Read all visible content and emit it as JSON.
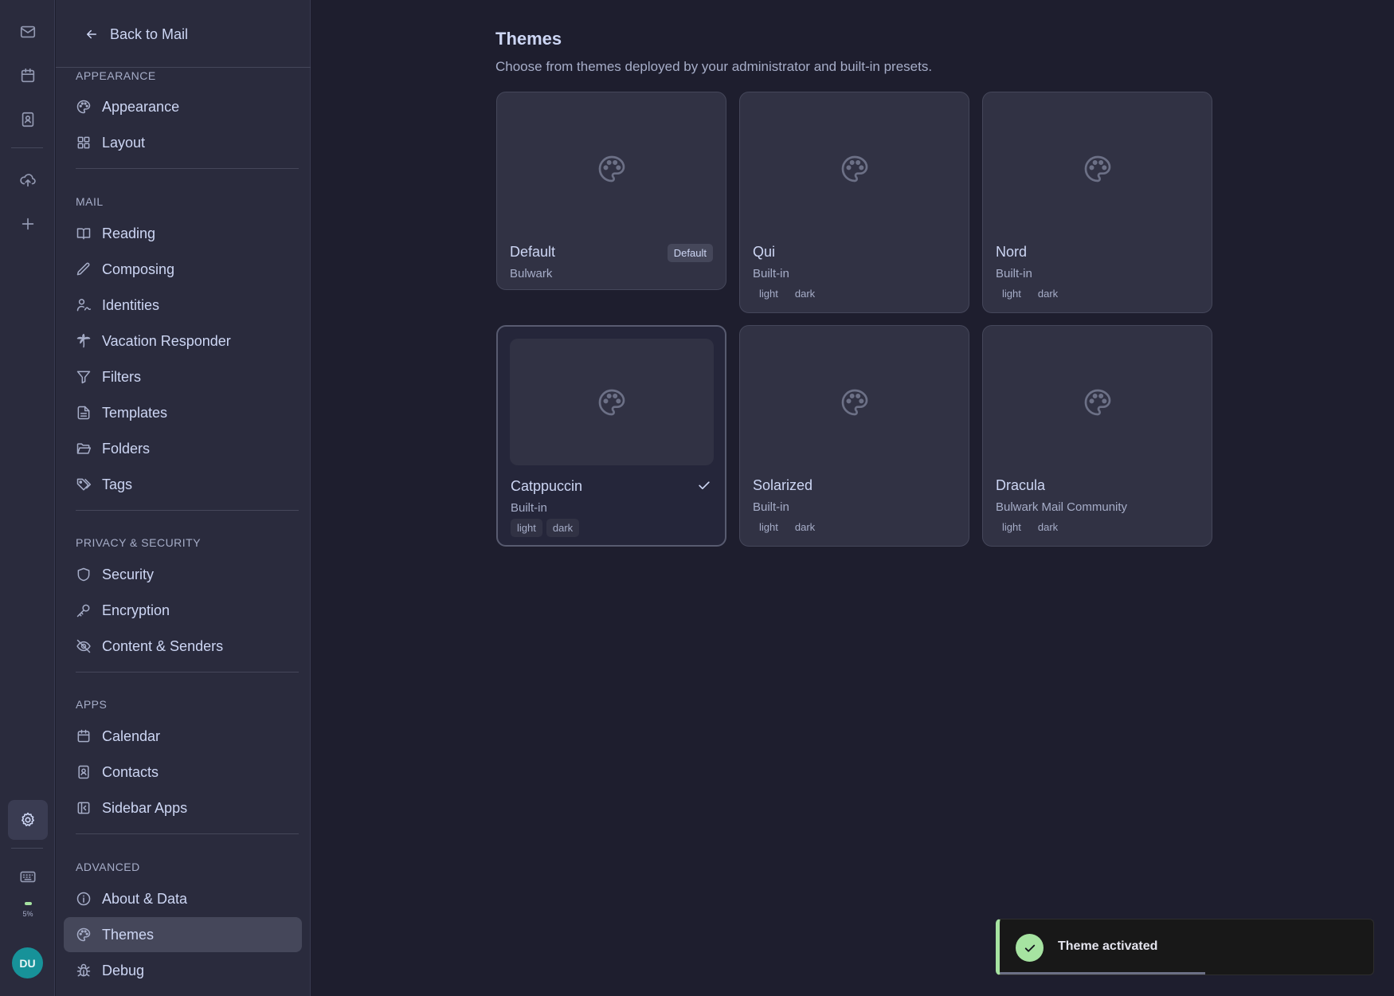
{
  "rail": {
    "icons": [
      "mail-icon",
      "calendar-icon",
      "contacts-icon",
      "cloud-upload-icon",
      "plus-icon",
      "settings-icon",
      "keyboard-icon"
    ],
    "storage_label": "5%",
    "storage_fraction": 0.05,
    "avatar_initials": "DU"
  },
  "sidebar": {
    "back_label": "Back to Mail",
    "sections": [
      {
        "title": "Appearance",
        "items": [
          {
            "label": "Appearance",
            "icon": "palette-icon"
          },
          {
            "label": "Layout",
            "icon": "layout-grid-icon"
          }
        ]
      },
      {
        "title": "Mail",
        "items": [
          {
            "label": "Reading",
            "icon": "book-icon"
          },
          {
            "label": "Composing",
            "icon": "pen-icon"
          },
          {
            "label": "Identities",
            "icon": "user-signature-icon"
          },
          {
            "label": "Vacation Responder",
            "icon": "palm-tree-icon"
          },
          {
            "label": "Filters",
            "icon": "filter-icon"
          },
          {
            "label": "Templates",
            "icon": "file-text-icon"
          },
          {
            "label": "Folders",
            "icon": "folder-open-icon"
          },
          {
            "label": "Tags",
            "icon": "tags-icon"
          }
        ]
      },
      {
        "title": "Privacy & Security",
        "items": [
          {
            "label": "Security",
            "icon": "shield-icon"
          },
          {
            "label": "Encryption",
            "icon": "key-icon"
          },
          {
            "label": "Content & Senders",
            "icon": "eye-off-icon"
          }
        ]
      },
      {
        "title": "Apps",
        "items": [
          {
            "label": "Calendar",
            "icon": "calendar-icon"
          },
          {
            "label": "Contacts",
            "icon": "contact-book-icon"
          },
          {
            "label": "Sidebar Apps",
            "icon": "panel-left-icon"
          }
        ]
      },
      {
        "title": "Advanced",
        "items": [
          {
            "label": "About & Data",
            "icon": "info-icon"
          },
          {
            "label": "Themes",
            "icon": "palette-icon",
            "active": true
          },
          {
            "label": "Debug",
            "icon": "bug-icon"
          }
        ]
      }
    ]
  },
  "main": {
    "title": "Themes",
    "subtitle": "Choose from themes deployed by your administrator and built-in presets.",
    "themes": [
      {
        "name": "Default",
        "source": "Bulwark",
        "badge": "Default",
        "tags": []
      },
      {
        "name": "Qui",
        "source": "Built-in",
        "tags": [
          "light",
          "dark"
        ]
      },
      {
        "name": "Nord",
        "source": "Built-in",
        "tags": [
          "light",
          "dark"
        ]
      },
      {
        "name": "Catppuccin",
        "source": "Built-in",
        "tags": [
          "light",
          "dark"
        ],
        "selected": true
      },
      {
        "name": "Solarized",
        "source": "Built-in",
        "tags": [
          "light",
          "dark"
        ]
      },
      {
        "name": "Dracula",
        "source": "Bulwark Mail Community",
        "tags": [
          "light",
          "dark"
        ]
      }
    ]
  },
  "toast": {
    "message": "Theme activated",
    "progress": 0.55,
    "icon": "check-icon",
    "accent_color": "#a6e3a1"
  }
}
